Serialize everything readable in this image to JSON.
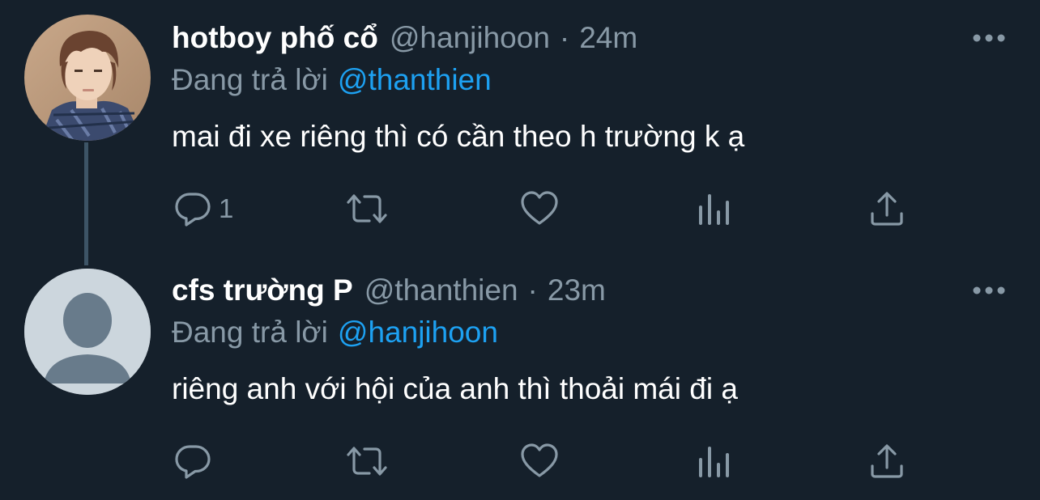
{
  "tweets": [
    {
      "display_name": "hotboy phố cổ",
      "handle": "@hanjihoon",
      "separator": "·",
      "time": "24m",
      "reply_prefix": "Đang trả lời",
      "reply_to": "@thanthien",
      "text": "mai đi xe riêng thì có cần theo h trường k ạ",
      "reply_count": "1",
      "avatar": "photo-avatar"
    },
    {
      "display_name": "cfs trường P",
      "handle": "@thanthien",
      "separator": "·",
      "time": "23m",
      "reply_prefix": "Đang trả lời",
      "reply_to": "@hanjihoon",
      "text": "riêng anh với hội của anh thì thoải mái đi ạ",
      "reply_count": "",
      "avatar": "default-avatar"
    }
  ],
  "icons": {
    "reply": "reply-icon",
    "retweet": "retweet-icon",
    "like": "heart-icon",
    "analytics": "analytics-icon",
    "share": "share-icon",
    "more": "more-icon"
  },
  "colors": {
    "background": "#15202b",
    "secondary_text": "#8899a6",
    "link": "#1da1f2",
    "thread_line": "#3d5466",
    "default_avatar_bg": "#ccd6dd",
    "default_avatar_fg": "#687b8b"
  }
}
